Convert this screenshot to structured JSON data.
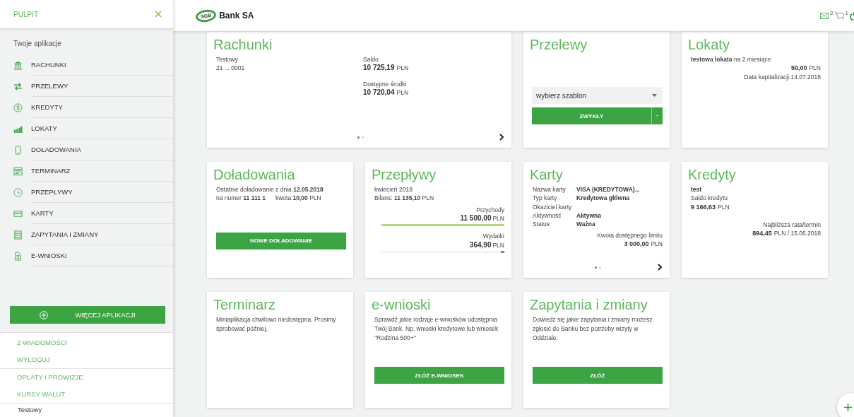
{
  "sidebar": {
    "title": "PULPIT",
    "section_label": "Twoje aplikacje",
    "items": [
      {
        "label": "RACHUNKI"
      },
      {
        "label": "PRZELEWY"
      },
      {
        "label": "KREDYTY"
      },
      {
        "label": "LOKATY"
      },
      {
        "label": "DOŁADOWANIA"
      },
      {
        "label": "TERMINARZ"
      },
      {
        "label": "PRZEPŁYWY"
      },
      {
        "label": "KARTY"
      },
      {
        "label": "ZAPYTANIA I ZMIANY"
      },
      {
        "label": "E-WNIOSKI"
      }
    ],
    "more_button": "WIĘCEJ APLIKACJI",
    "links": [
      {
        "label": "2 WIADOMOŚCI",
        "divider_after": false
      },
      {
        "label": "WYLOGUJ",
        "divider_after": true
      },
      {
        "label": "OPŁATY I PROWIZJE",
        "divider_after": false
      },
      {
        "label": "KURSY WALUT",
        "divider_after": true
      }
    ],
    "footer_text": "Testowy"
  },
  "header": {
    "logo_mark": "SGB",
    "logo_text": "Bank SA",
    "messages_count": "2",
    "cart_count": "1"
  },
  "cards": [
    {
      "kind": "account",
      "wide": true,
      "title": "Rachunki",
      "name": "Testowy",
      "number": "21 ... 0001",
      "balances": [
        {
          "label": "Saldo",
          "amount": "10 725,19",
          "currency": "PLN"
        },
        {
          "label": "Dostępne środki",
          "amount": "10 720,04",
          "currency": "PLN"
        }
      ],
      "dots": [
        {
          "selected": true
        },
        {
          "selected": false
        }
      ]
    },
    {
      "kind": "transfer",
      "title": "Przelewy",
      "select_value": "wybierz szablon",
      "button": "ZWYKŁY"
    },
    {
      "kind": "deposit",
      "title": "Lokaty",
      "line": "**testowa lokata** na 2 miesiące",
      "amount": "50,00",
      "currency": "PLN",
      "note": "Data kapitalizacji 14.07.2018"
    },
    {
      "kind": "topup",
      "title": "Doładowania",
      "line1": "Ostatnie doładowanie z dnia **12.05.2018**",
      "number": "na numer **11 111 1**",
      "amount": "kwota **10,00**  PLN",
      "button": "NOWE DOŁADOWANIE"
    },
    {
      "kind": "flow",
      "title": "Przepływy",
      "month": "kwiecień 2018",
      "balance": "Bilans: **11 135,10** PLN",
      "rows": [
        {
          "label": "Przychody",
          "amount": "11 500,00",
          "currency": "PLN",
          "level": 1,
          "color": "#b5d77a"
        },
        {
          "label": "Wydatki",
          "amount": "364,90",
          "currency": "PLN",
          "level": 0.03,
          "color": "#a86ad0"
        }
      ]
    },
    {
      "kind": "card",
      "title": "Karty",
      "fields": [
        {
          "label": "Nazwa karty",
          "value": "VISA (KREDYTOWA)..."
        },
        {
          "label": "Typ karty",
          "value": "Kredytowa główna"
        },
        {
          "label": "Okaziciel karty"
        },
        {
          "label": "Aktywność",
          "value": "Aktywna"
        },
        {
          "label": "Status",
          "value": "Ważna"
        }
      ],
      "limit_label": "Kwota dostępnego limitu",
      "amount": "3 000,00",
      "currency": "PLN",
      "dots": [
        {
          "selected": true
        },
        {
          "selected": false
        }
      ]
    },
    {
      "kind": "loan",
      "title": "Kredyty",
      "name": "test",
      "balance_label": "Saldo kredytu",
      "amount": "9 166,63",
      "currency": "PLN",
      "next_label": "Najbliższa rata/termin",
      "next_amount": "894,45",
      "next_rest": "PLN / 15.06.2018"
    },
    {
      "kind": "note",
      "title": "Terminarz",
      "text": "Miniaplikacja chwilowo niedostępna. Prosimy sprobować później."
    },
    {
      "kind": "note",
      "title": "e-wnioski",
      "text": "Sprawdź jakie rodzaje e-wniosków udostępnia Twój Bank. Np. wnioski kredytowe lub wniosek \"Rodzina 500+\"",
      "button": "ZŁÓŻ E-WNIOSEK"
    },
    {
      "kind": "note",
      "title": "Zapytania i zmiany",
      "text": "Dowiedz się jakie zapytania i zmiany możesz zgłosić do Banku bez potrzeby wizyty w Oddziale.",
      "button": "ZŁÓŻ"
    }
  ]
}
